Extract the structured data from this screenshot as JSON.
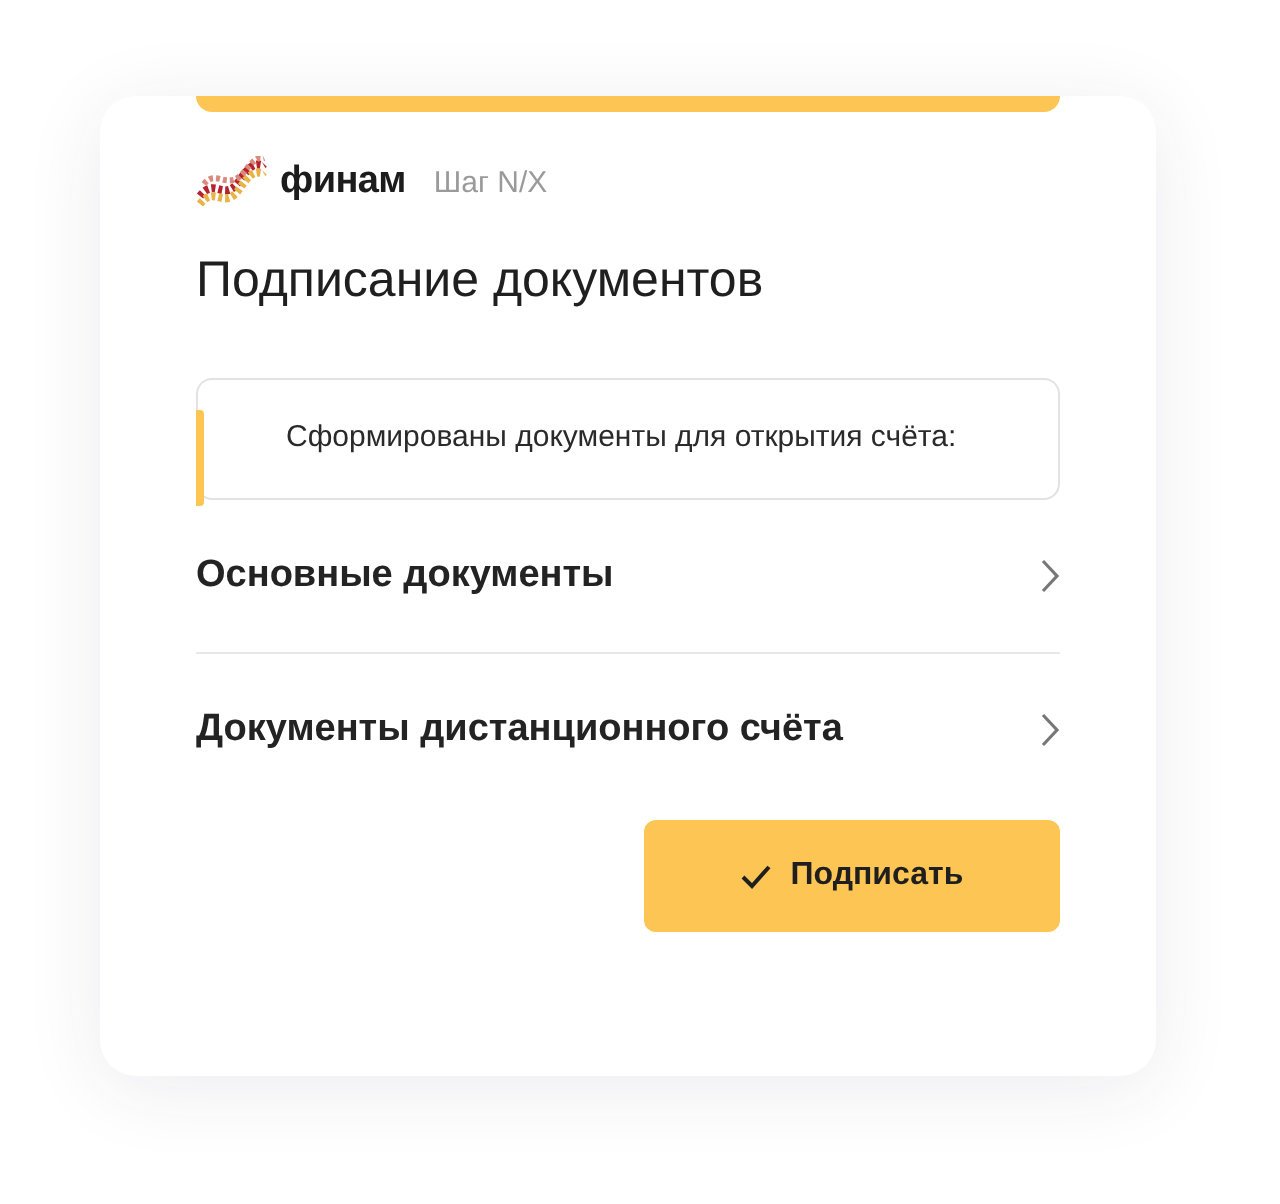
{
  "header": {
    "brand": "финам",
    "step": "Шаг N/X"
  },
  "title": "Подписание документов",
  "notice": "Сформированы документы для открытия счёта:",
  "items": [
    {
      "label": "Основные документы"
    },
    {
      "label": "Документы дистанционного счёта"
    }
  ],
  "button": {
    "label": "Подписать"
  }
}
